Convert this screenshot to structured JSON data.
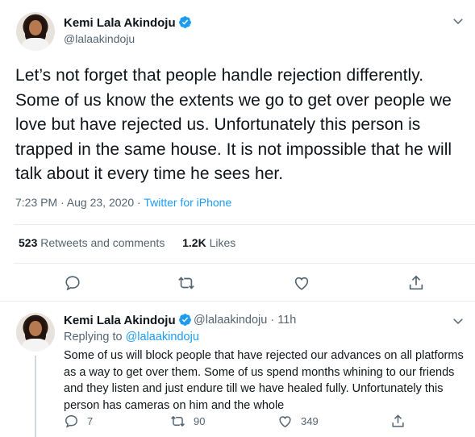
{
  "main_tweet": {
    "author_name": "Kemi Lala Akindoju",
    "author_handle": "@lalaakindoju",
    "text": "Let’s not forget that people handle rejection differently. Some of us know the extents we go to get over people we love but have rejected us. Unfortunately this person is trapped in the same house. It is not impossible that he will talk about it every time he sees her.",
    "timestamp": "7:23 PM · Aug 23, 2020",
    "separator": " · ",
    "source": "Twitter for iPhone",
    "retweets_count": "523",
    "retweets_label": "Retweets and comments",
    "likes_count": "1.2K",
    "likes_label": "Likes",
    "icons": [
      "reply-icon",
      "retweet-icon",
      "like-icon",
      "share-icon"
    ]
  },
  "reply_tweet": {
    "author_name": "Kemi Lala Akindoju",
    "author_handle": "@lalaakindoju",
    "time_ago": "11h",
    "replying_prefix": "Replying to ",
    "replying_to": "@lalaakindoju",
    "text": "Some of us will block people that have rejected our advances on all platforms as a way to get over them.  Some of us spend months whining to our friends and they listen and just endure till we have healed fully. Unfortunately this person has cameras on him and the whole",
    "reply_count": "7",
    "retweet_count": "90",
    "like_count": "349"
  },
  "colors": {
    "accent": "#1d9bf0",
    "secondary_text": "#536471",
    "primary_text": "#0f1419",
    "divider": "#e6ecf0"
  }
}
